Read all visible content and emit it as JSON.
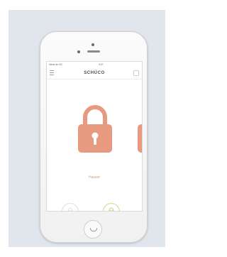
{
  "status_bar": {
    "carrier": "Netzt.de 3G",
    "time": "9:07",
    "battery": ""
  },
  "app_header": {
    "brand": "SCHÜCO"
  },
  "lock_panel": {
    "status_label": "Hauser"
  },
  "tabs": [
    {
      "name": "person-icon"
    },
    {
      "name": "gear-icon"
    },
    {
      "name": "document-icon"
    }
  ],
  "colors": {
    "lock_accent": "#e79a80",
    "unlock_accent": "#c9dc8a",
    "background_panel": "#e1e6ec"
  }
}
